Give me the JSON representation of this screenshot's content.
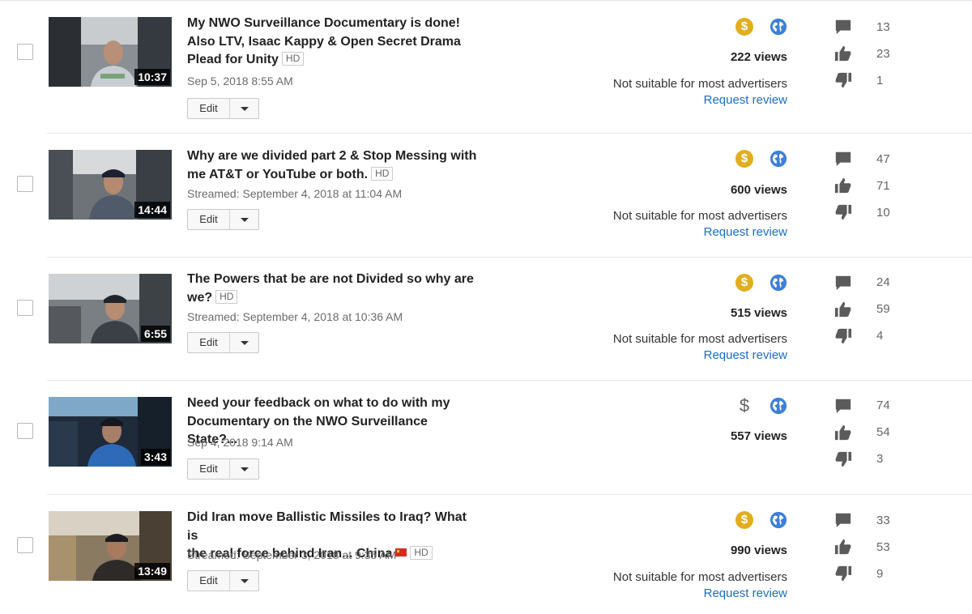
{
  "video_rows": [
    {
      "title_lines": [
        "My NWO Surveillance Documentary is done!",
        "Also LTV, Isaac Kappy & Open Secret Drama",
        "Plead for Unity"
      ],
      "hd_label": "HD",
      "date": "Sep 5, 2018 8:55 AM",
      "duration": "10:37",
      "edit_label": "Edit",
      "views": "222 views",
      "ad_status": "Not suitable for most advertisers",
      "review_link": "Request review",
      "monetization_icon": "dollar-circle-icon",
      "comments": "13",
      "likes": "23",
      "dislikes": "1"
    },
    {
      "title_lines": [
        "Why are we divided part 2 & Stop Messing with",
        "me AT&T or YouTube or both."
      ],
      "hd_label": "HD",
      "date": "Streamed: September 4, 2018 at 11:04 AM",
      "duration": "14:44",
      "edit_label": "Edit",
      "views": "600 views",
      "ad_status": "Not suitable for most advertisers",
      "review_link": "Request review",
      "monetization_icon": "dollar-circle-icon",
      "comments": "47",
      "likes": "71",
      "dislikes": "10"
    },
    {
      "title_lines": [
        "The Powers that be are not Divided so why are",
        "we?"
      ],
      "hd_label": "HD",
      "date": "Streamed: September 4, 2018 at 10:36 AM",
      "duration": "6:55",
      "edit_label": "Edit",
      "views": "515 views",
      "ad_status": "Not suitable for most advertisers",
      "review_link": "Request review",
      "monetization_icon": "dollar-circle-icon",
      "comments": "24",
      "likes": "59",
      "dislikes": "4"
    },
    {
      "title_lines": [
        "Need your feedback on what to do with my",
        "Documentary on the NWO Surveillance State?..."
      ],
      "hd_label": "",
      "date": "Sep 4, 2018 9:14 AM",
      "duration": "3:43",
      "edit_label": "Edit",
      "views": "557 views",
      "ad_status": "",
      "review_link": "",
      "monetization_icon": "dollar-sign-icon",
      "comments": "74",
      "likes": "54",
      "dislikes": "3"
    },
    {
      "title_lines": [
        "Did Iran move Ballistic Missiles to Iraq? What is",
        "the real force behind Iran... China"
      ],
      "hd_label": "HD",
      "date": "Streamed: September 3, 2018 at 9:35 AM",
      "duration": "13:49",
      "edit_label": "Edit",
      "views": "990 views",
      "ad_status": "Not suitable for most advertisers",
      "review_link": "Request review",
      "monetization_icon": "dollar-circle-icon",
      "comments": "33",
      "likes": "53",
      "dislikes": "9"
    }
  ],
  "colors": {
    "monetized": "#e2ad1e",
    "globe": "#3f7fd6",
    "link": "#1a6dc4",
    "stat_icon": "#5b5b5b"
  }
}
